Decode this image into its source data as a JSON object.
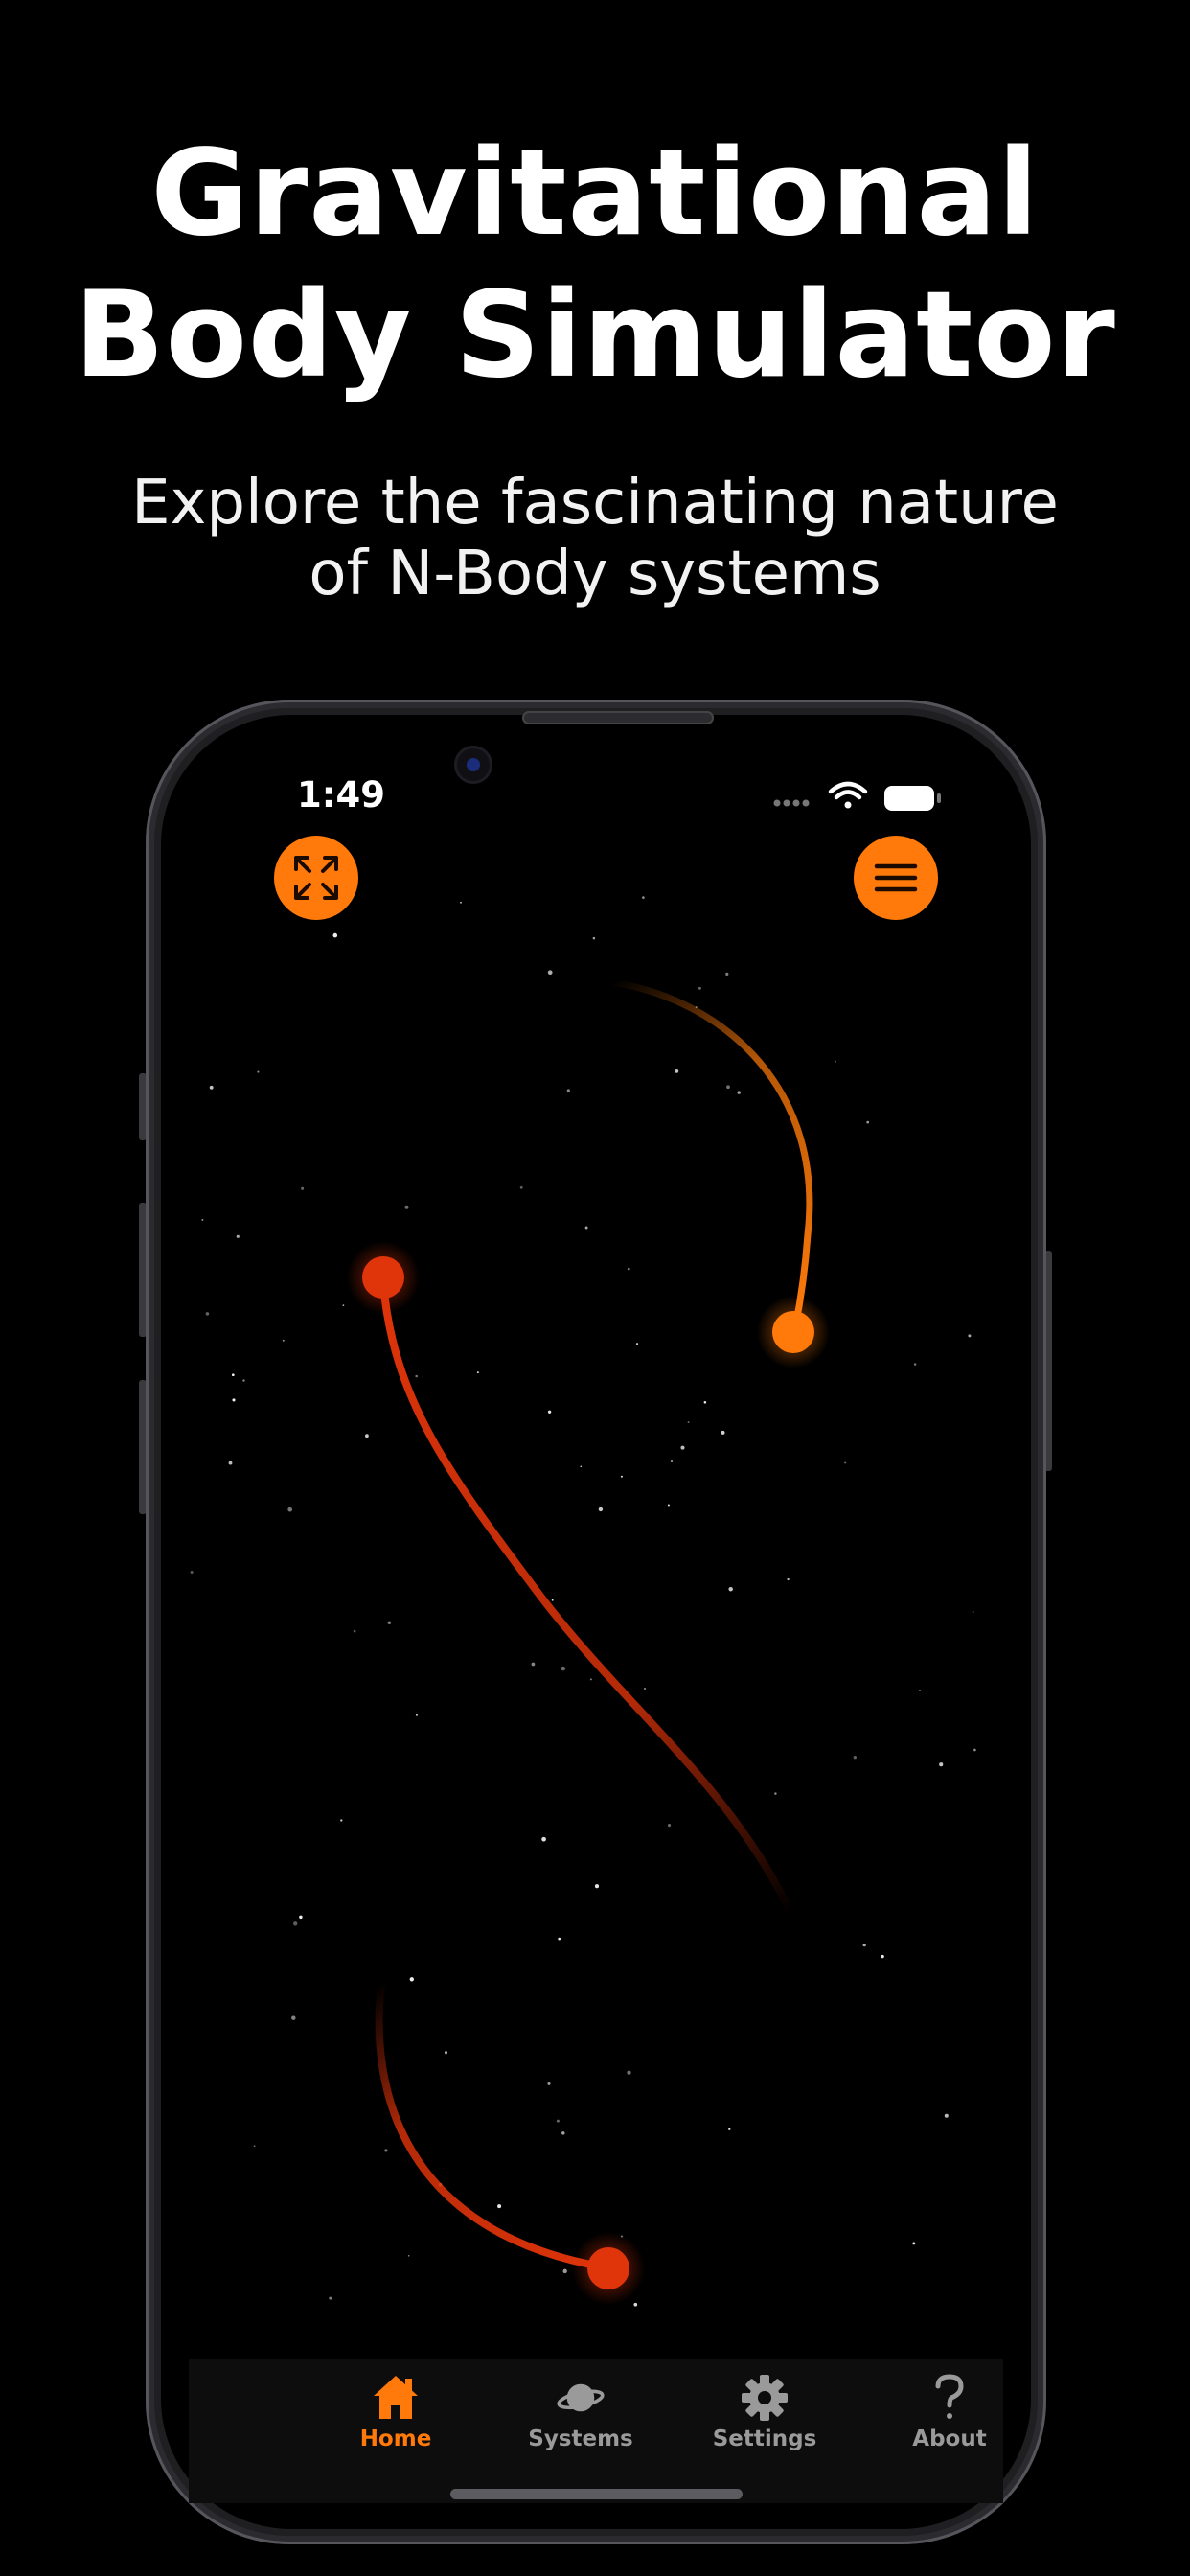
{
  "headline": {
    "line1": "Gravitational",
    "line2": "Body Simulator"
  },
  "subtitle": {
    "line1": "Explore the fascinating nature",
    "line2": "of N-Body systems"
  },
  "status_bar": {
    "time": "1:49"
  },
  "controls": {
    "expand_icon": "expand-arrows-icon",
    "menu_icon": "hamburger-menu-icon"
  },
  "tabs": [
    {
      "label": "Home",
      "icon": "house-icon",
      "active": true
    },
    {
      "label": "Systems",
      "icon": "planet-icon",
      "active": false
    },
    {
      "label": "Settings",
      "icon": "gear-icon",
      "active": false
    },
    {
      "label": "About",
      "icon": "question-icon",
      "active": false
    }
  ],
  "colors": {
    "accent": "#ff7a0a",
    "body_red": "#e0340a",
    "background": "#000000",
    "inactive": "#9a9a9a"
  }
}
